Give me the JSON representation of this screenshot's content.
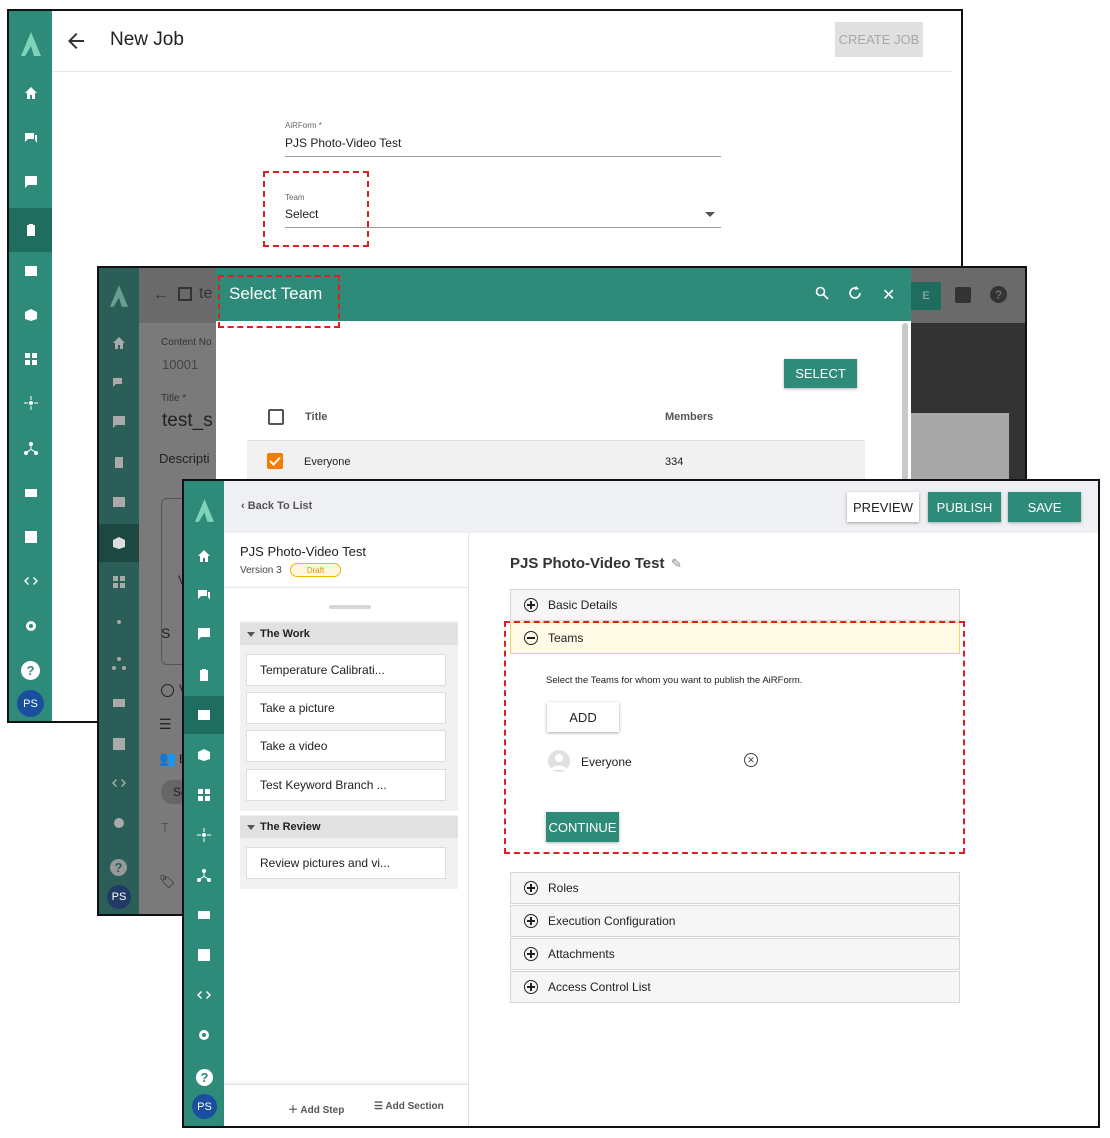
{
  "window1": {
    "title": "New Job",
    "create_button": "CREATE JOB",
    "airform_label": "AiRForm *",
    "airform_value": "PJS Photo-Video Test",
    "team_label": "Team",
    "team_value": "Select",
    "avatar": "PS"
  },
  "window2": {
    "header_partial": "te",
    "content_no_label": "Content No",
    "content_no_value": "10001",
    "title_label": "Title *",
    "title_value": "test_s",
    "description_label": "Descripti",
    "bg_fragments": [
      "V",
      "Cha",
      "S",
      "V",
      "Ev",
      "Sele",
      "T"
    ],
    "avatar": "PS",
    "dialog": {
      "title": "Select Team",
      "select_button": "SELECT",
      "col_title": "Title",
      "col_members": "Members",
      "rows": [
        {
          "title": "Everyone",
          "members": "334",
          "checked": true
        }
      ],
      "header_partial_btn": "E"
    }
  },
  "window3": {
    "back_label": "Back To List",
    "preview_button": "PREVIEW",
    "publish_button": "PUBLISH",
    "save_button": "SAVE",
    "form_title": "PJS Photo-Video Test",
    "version": "Version 3",
    "status": "Draft",
    "sections": [
      {
        "name": "The Work",
        "steps": [
          "Temperature Calibrati...",
          "Take a picture",
          "Take a video",
          "Test Keyword Branch ..."
        ]
      },
      {
        "name": "The Review",
        "steps": [
          "Review pictures and vi..."
        ]
      }
    ],
    "add_step": "Add Step",
    "add_section": "Add Section",
    "main_title": "PJS Photo-Video Test",
    "accordion": {
      "basic_details": "Basic Details",
      "teams": "Teams",
      "teams_desc": "Select the Teams for whom you want to publish the AiRForm.",
      "add_button": "ADD",
      "team_member": "Everyone",
      "continue_button": "CONTINUE",
      "roles": "Roles",
      "execution": "Execution Configuration",
      "attachments": "Attachments",
      "acl": "Access Control List"
    },
    "avatar": "PS"
  },
  "colors": {
    "accent": "#2e8b7a",
    "highlight": "#e02020",
    "checkbox": "#f57c00",
    "draft": "#f5b400",
    "avatar": "#1a4fa0"
  }
}
